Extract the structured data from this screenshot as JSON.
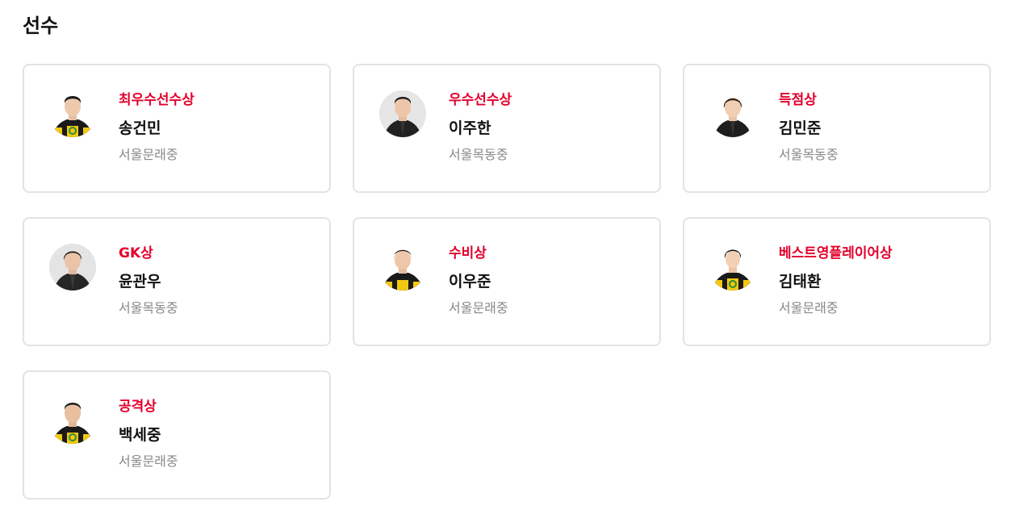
{
  "section": {
    "title": "선수"
  },
  "players": [
    {
      "award": "최우수선수상",
      "name": "송건민",
      "school": "서울문래중",
      "photo": "player-photo-uniform"
    },
    {
      "award": "우수선수상",
      "name": "이주한",
      "school": "서울목동중",
      "photo": "player-photo-jacket"
    },
    {
      "award": "득점상",
      "name": "김민준",
      "school": "서울목동중",
      "photo": "player-photo-jacket"
    },
    {
      "award": "GK상",
      "name": "윤관우",
      "school": "서울목동중",
      "photo": "player-photo-jacket"
    },
    {
      "award": "수비상",
      "name": "이우준",
      "school": "서울문래중",
      "photo": "player-photo-uniform"
    },
    {
      "award": "베스트영플레이어상",
      "name": "김태환",
      "school": "서울문래중",
      "photo": "player-photo-uniform"
    },
    {
      "award": "공격상",
      "name": "백세중",
      "school": "서울문래중",
      "photo": "player-photo-uniform"
    }
  ],
  "colors": {
    "award_red": "#e3002b",
    "name_text": "#111111",
    "school_text": "#888888",
    "card_border": "#e3e3e3",
    "uniform_yellow": "#f2c811",
    "uniform_black": "#1a1a1a"
  }
}
